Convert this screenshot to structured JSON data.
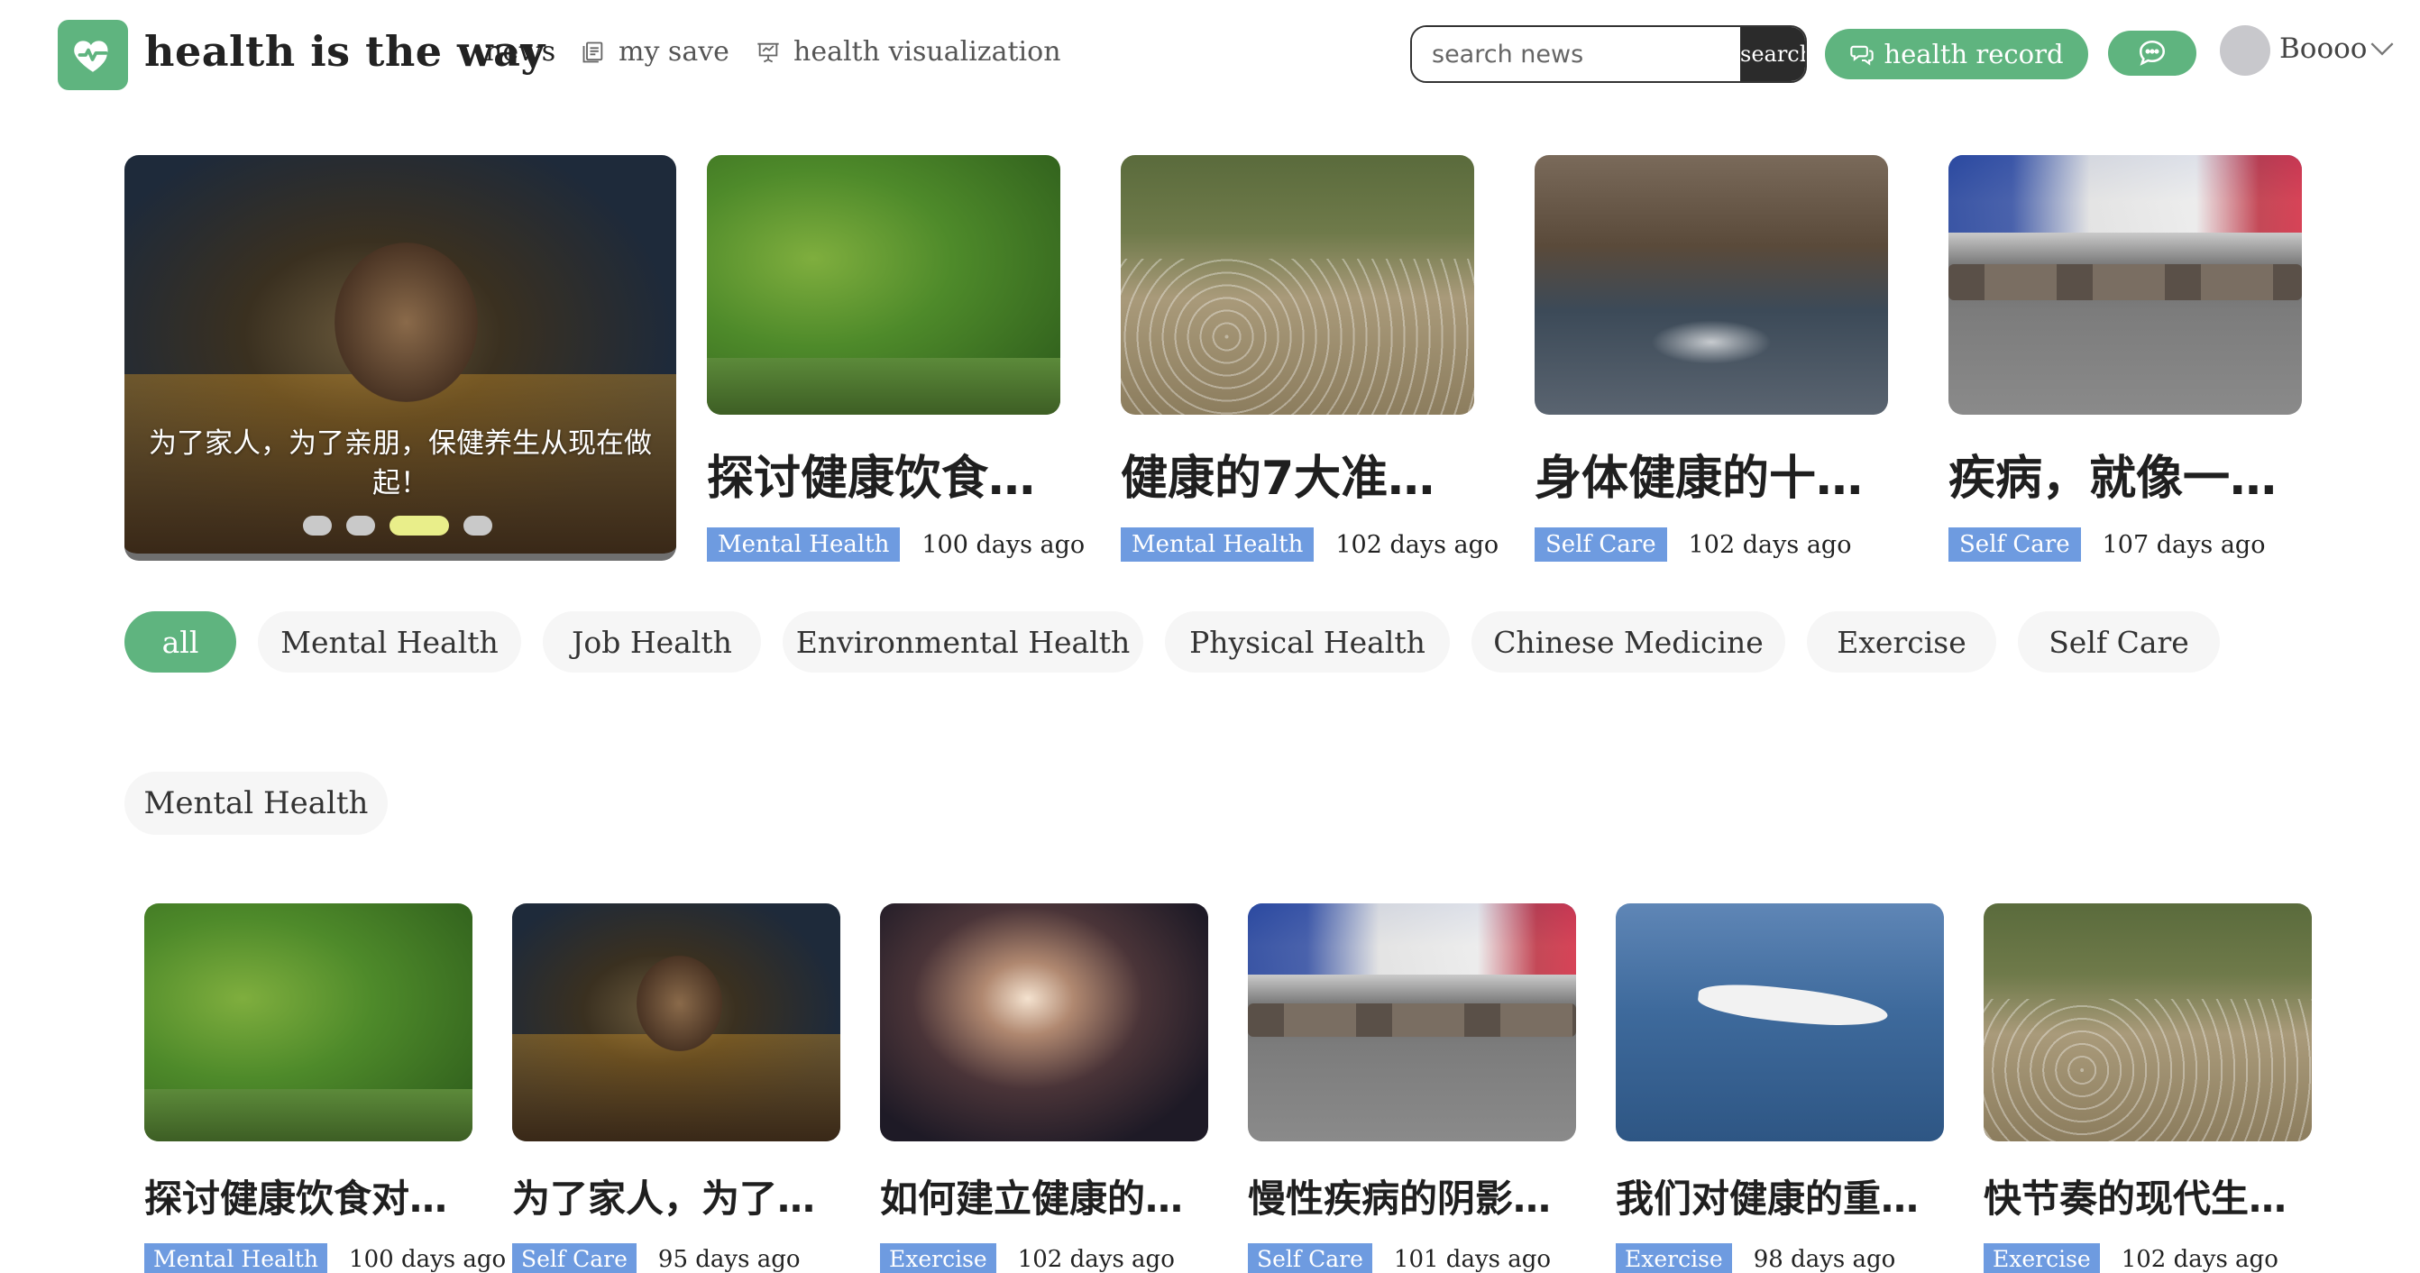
{
  "header": {
    "brand": "health is the way",
    "nav": {
      "news": "news",
      "save": "my save",
      "viz": "health visualization"
    },
    "search_placeholder": "search news",
    "search_button": "search",
    "record_button": "health record",
    "username": "Boooo"
  },
  "carousel": {
    "caption": "为了家人，为了亲朋，保健养生从现在做起！",
    "dots": 4,
    "active_dot": 3
  },
  "featured": [
    {
      "title": "探讨健康饮食…",
      "tag": "Mental Health",
      "ago": "100 days ago"
    },
    {
      "title": "健康的7大准…",
      "tag": "Mental Health",
      "ago": "102 days ago"
    },
    {
      "title": "身体健康的十…",
      "tag": "Self Care",
      "ago": "102 days ago"
    },
    {
      "title": "疾病，就像一…",
      "tag": "Self Care",
      "ago": "107 days ago"
    }
  ],
  "categories": [
    "all",
    "Mental Health",
    "Job Health",
    "Environmental Health",
    "Physical Health",
    "Chinese Medicine",
    "Exercise",
    "Self Care"
  ],
  "active_category": "all",
  "section": {
    "label": "Mental Health"
  },
  "grid": [
    {
      "title": "探讨健康饮食对…",
      "tag": "Mental Health",
      "ago": "100 days ago"
    },
    {
      "title": "为了家人，为了…",
      "tag": "Self Care",
      "ago": "95 days ago"
    },
    {
      "title": "如何建立健康的…",
      "tag": "Exercise",
      "ago": "102 days ago"
    },
    {
      "title": "慢性疾病的阴影…",
      "tag": "Self Care",
      "ago": "101 days ago"
    },
    {
      "title": "我们对健康的重…",
      "tag": "Exercise",
      "ago": "98 days ago"
    },
    {
      "title": "快节奏的现代生…",
      "tag": "Exercise",
      "ago": "102 days ago"
    }
  ],
  "colors": {
    "accent": "#5fb47f",
    "tag": "#6e9be0",
    "active_dot": "#e9ee8a"
  },
  "icons": {
    "logo": "heart-pulse-icon",
    "save": "bookmark-list-icon",
    "viz": "presentation-chart-icon",
    "record": "chat-bubbles-icon",
    "chat": "chat-dots-icon",
    "chevron": "chevron-down-icon"
  }
}
